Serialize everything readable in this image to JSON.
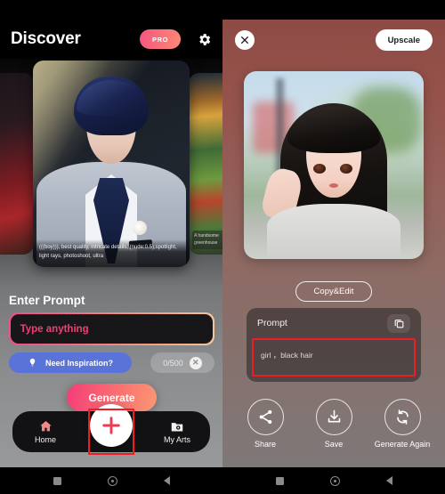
{
  "left": {
    "header": {
      "title": "Discover",
      "pro_label": "PRO",
      "settings_icon": "gear-icon"
    },
    "carousel": {
      "main_caption": "(((boy))), best quality, intricate details, (nude:0.5),spotlight, light rays, photoshoot, ultra",
      "right_caption": "A handsome greenhouse"
    },
    "prompt_section": {
      "label": "Enter Prompt",
      "input_placeholder": "Type anything",
      "input_value": "",
      "inspiration_label": "Need Inspiration?",
      "inspiration_icon": "lightbulb-icon",
      "counter": "0/500",
      "clear_icon": "close-icon"
    },
    "generate_label": "Generate",
    "tabbar": {
      "items": [
        {
          "label": "Home",
          "icon": "home-icon"
        },
        {
          "label": "My Arts",
          "icon": "folder-camera-icon"
        }
      ],
      "fab_icon": "plus-icon"
    }
  },
  "right": {
    "header": {
      "close_icon": "close-icon",
      "upscale_label": "Upscale"
    },
    "copy_edit_label": "Copy&Edit",
    "prompt_card": {
      "title": "Prompt",
      "copy_icon": "copy-icon",
      "text": "girl ，black hair"
    },
    "actions": [
      {
        "label": "Share",
        "icon": "share-icon"
      },
      {
        "label": "Save",
        "icon": "download-icon"
      },
      {
        "label": "Generate Again",
        "icon": "refresh-icon"
      }
    ]
  },
  "colors": {
    "accent_pink": "#f43d78",
    "accent_orange": "#fb9773",
    "inspiration_blue": "#5a73d8",
    "highlight_red": "#ee1c25",
    "right_panel_top": "#8e4b45"
  }
}
